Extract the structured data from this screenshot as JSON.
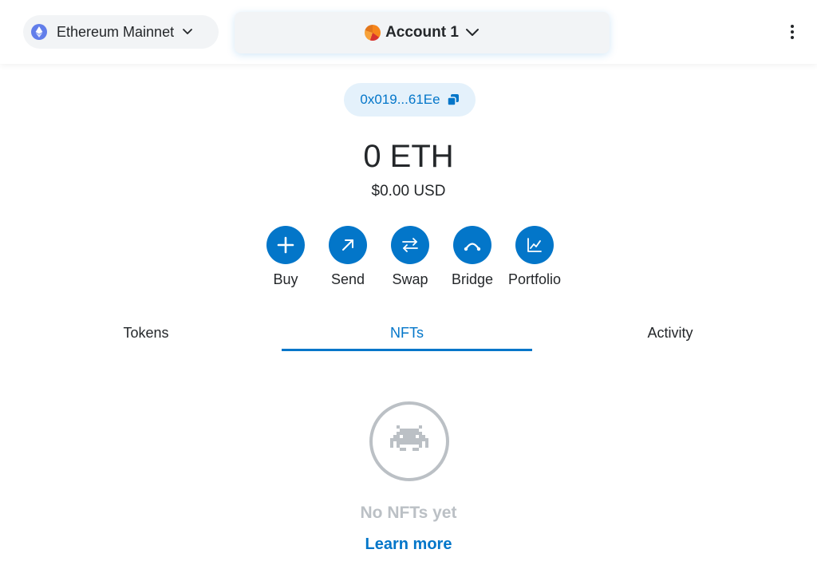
{
  "header": {
    "network": {
      "label": "Ethereum Mainnet",
      "icon": "ethereum-icon"
    },
    "account": {
      "label": "Account 1",
      "icon": "account-avatar"
    },
    "menu_icon": "kebab-menu-icon"
  },
  "address": {
    "short": "0x019...61Ee",
    "icon": "copy-icon"
  },
  "balance": {
    "primary": "0 ETH",
    "fiat": "$0.00 USD"
  },
  "actions": [
    {
      "label": "Buy",
      "icon": "plus-icon"
    },
    {
      "label": "Send",
      "icon": "arrow-up-right-icon"
    },
    {
      "label": "Swap",
      "icon": "swap-arrows-icon"
    },
    {
      "label": "Bridge",
      "icon": "bridge-icon"
    },
    {
      "label": "Portfolio",
      "icon": "chart-icon"
    }
  ],
  "tabs": [
    {
      "label": "Tokens",
      "active": false
    },
    {
      "label": "NFTs",
      "active": true
    },
    {
      "label": "Activity",
      "active": false
    }
  ],
  "empty_state": {
    "icon": "space-invader-icon",
    "message": "No NFTs yet",
    "link": "Learn more"
  },
  "colors": {
    "accent": "#0376c9",
    "muted": "#bbc0c5",
    "pill_bg": "#f2f4f6",
    "address_bg": "#e4f1fb"
  }
}
